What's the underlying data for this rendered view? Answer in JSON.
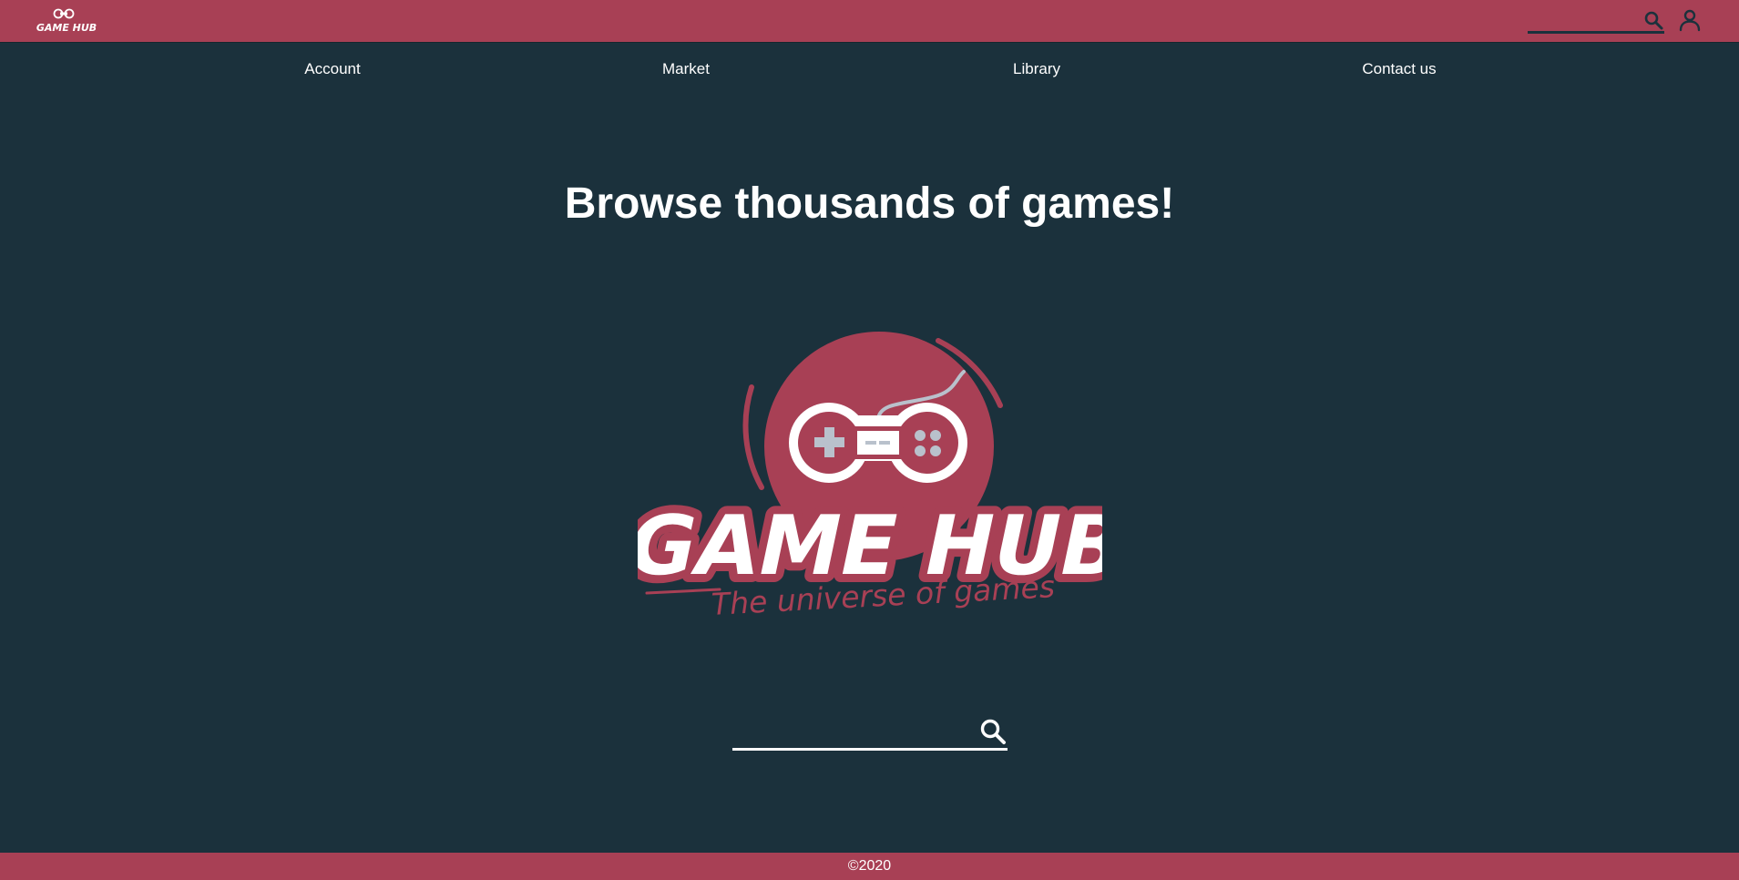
{
  "header": {
    "logo_text": "GAME HUB",
    "search": {
      "placeholder": "",
      "value": ""
    },
    "icons": {
      "search": "search-icon",
      "user": "user-icon"
    }
  },
  "nav": {
    "items": [
      {
        "label": "Account"
      },
      {
        "label": "Market"
      },
      {
        "label": "Library"
      },
      {
        "label": "Contact us"
      }
    ]
  },
  "hero": {
    "headline": "Browse thousands of games!",
    "logo": {
      "title": "GAME HUB",
      "tagline": "The universe of games"
    }
  },
  "search": {
    "placeholder": "",
    "value": "",
    "icon": "search-icon"
  },
  "footer": {
    "copyright": "©2020"
  },
  "colors": {
    "brand": "#a84055",
    "background": "#1b313c",
    "text": "#ffffff",
    "icon_light": "#b9c1cc"
  }
}
